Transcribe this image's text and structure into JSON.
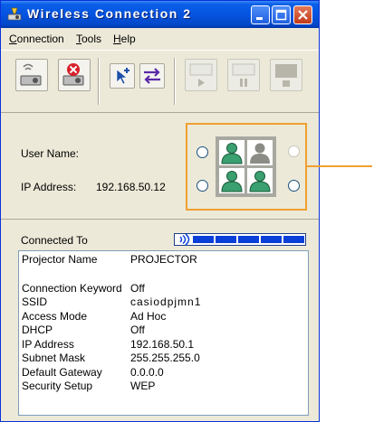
{
  "window": {
    "title": "Wireless Connection 2",
    "colors": {
      "titlebar": "#0454e0",
      "accent": "#f0a030",
      "progress": "#0a3fd8"
    }
  },
  "menu": [
    {
      "label_prefix": "",
      "underline": "C",
      "label_rest": "onnection"
    },
    {
      "label_prefix": "",
      "underline": "T",
      "label_rest": "ools"
    },
    {
      "label_prefix": "",
      "underline": "H",
      "label_rest": "elp"
    }
  ],
  "toolbar": {
    "icons": [
      "projector-search-icon",
      "projector-disconnect-icon",
      "select-add-icon",
      "swap-icon",
      "playback-play-icon",
      "playback-pause-icon",
      "playback-stop-icon"
    ]
  },
  "connection": {
    "user_name_label": "User Name:",
    "user_name_value": "",
    "ip_label": "IP Address:",
    "ip_value": "192.168.50.12"
  },
  "bottom": {
    "connected_to_label": "Connected To",
    "signal_bars": 5,
    "info": [
      {
        "k": "Projector Name",
        "v": "PROJECTOR"
      },
      {
        "k": "Connection Keyword",
        "v": "Off"
      },
      {
        "k": "SSID",
        "v": "casiodpjmn1"
      },
      {
        "k": "Access Mode",
        "v": "Ad Hoc"
      },
      {
        "k": "DHCP",
        "v": "Off"
      },
      {
        "k": "IP Address",
        "v": "192.168.50.1"
      },
      {
        "k": "Subnet Mask",
        "v": "255.255.255.0"
      },
      {
        "k": "Default Gateway",
        "v": "0.0.0.0"
      },
      {
        "k": "Security Setup",
        "v": "WEP"
      }
    ]
  }
}
